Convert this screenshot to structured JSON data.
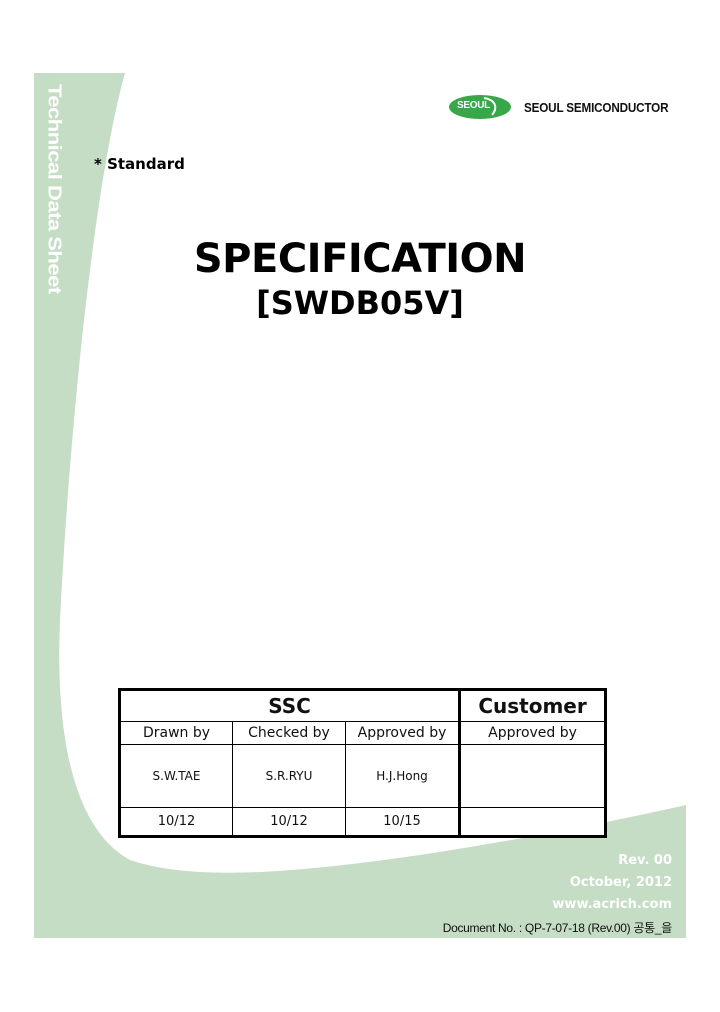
{
  "colors": {
    "band_green": "#c5dcc5",
    "logo_green": "#3aa64a",
    "page_bg": "#ffffff"
  },
  "side_title": "Technical Data Sheet",
  "logo": {
    "badge_text": "SEOUL",
    "company_name": "SEOUL SEMICONDUCTOR"
  },
  "category": "* Standard",
  "title": "SPECIFICATION",
  "model": "[SWDB05V]",
  "approval_table": {
    "groups": [
      "SSC",
      "Customer"
    ],
    "roles": [
      "Drawn by",
      "Checked  by",
      "Approved  by",
      "Approved by"
    ],
    "names": [
      "S.W.TAE",
      "S.R.RYU",
      "H.J.Hong",
      ""
    ],
    "dates": [
      "10/12",
      "10/12",
      "10/15",
      ""
    ]
  },
  "footer": {
    "revision": "Rev. 00",
    "date": "October, 2012",
    "website": "www.acrich.com",
    "document_no": "Document No. : QP-7-07-18 (Rev.00) 공통_을"
  }
}
